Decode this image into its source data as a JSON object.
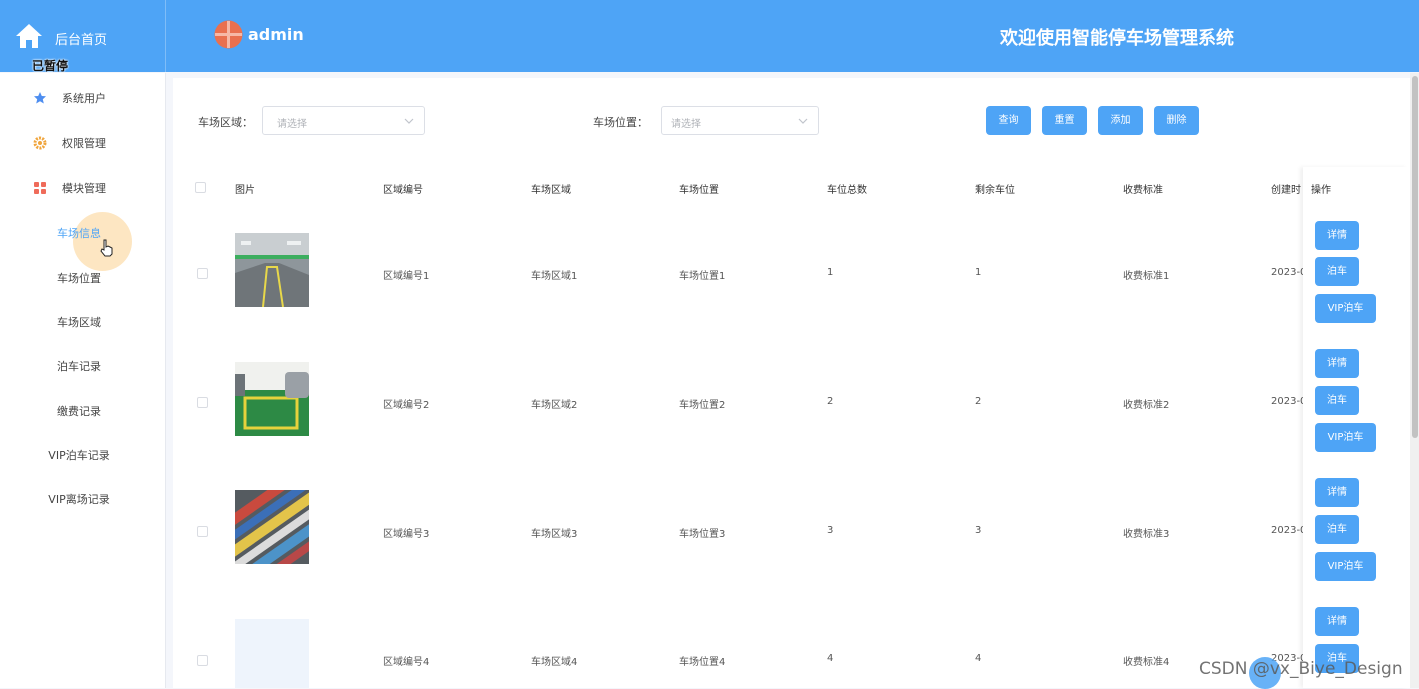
{
  "header": {
    "home_label": "后台首页",
    "paused_label": "已暂停",
    "username": "admin",
    "app_title": "欢迎使用智能停车场管理系统"
  },
  "sidebar": {
    "items": [
      {
        "label": "系统用户",
        "icon": "star-icon"
      },
      {
        "label": "权限管理",
        "icon": "gear-icon"
      },
      {
        "label": "模块管理",
        "icon": "grid-icon"
      }
    ],
    "sub_items": [
      {
        "label": "车场信息",
        "active": true
      },
      {
        "label": "车场位置"
      },
      {
        "label": "车场区域"
      },
      {
        "label": "泊车记录"
      },
      {
        "label": "缴费记录"
      },
      {
        "label": "VIP泊车记录"
      },
      {
        "label": "VIP离场记录"
      }
    ]
  },
  "filters": {
    "area_label": "车场区域：",
    "area_placeholder": "请选择",
    "location_label": "车场位置：",
    "location_placeholder": "请选择"
  },
  "toolbar": {
    "query": "查询",
    "reset": "重置",
    "add": "添加",
    "delete": "删除"
  },
  "table": {
    "columns": [
      "图片",
      "区域编号",
      "车场区域",
      "车场位置",
      "车位总数",
      "剩余车位",
      "收费标准",
      "创建时",
      "操作"
    ],
    "rows": [
      {
        "zone_no": "区域编号1",
        "area": "车场区域1",
        "location": "车场位置1",
        "total": "1",
        "remaining": "1",
        "fee": "收费标准1",
        "created": "2023-0"
      },
      {
        "zone_no": "区域编号2",
        "area": "车场区域2",
        "location": "车场位置2",
        "total": "2",
        "remaining": "2",
        "fee": "收费标准2",
        "created": "2023-0"
      },
      {
        "zone_no": "区域编号3",
        "area": "车场区域3",
        "location": "车场位置3",
        "total": "3",
        "remaining": "3",
        "fee": "收费标准3",
        "created": "2023-0"
      },
      {
        "zone_no": "区域编号4",
        "area": "车场区域4",
        "location": "车场位置4",
        "total": "4",
        "remaining": "4",
        "fee": "收费标准4",
        "created": "2023-0"
      }
    ],
    "actions": {
      "detail": "详情",
      "park": "泊车",
      "vip_park": "VIP泊车"
    }
  },
  "watermark": "CSDN @vx_Biye_Design",
  "colors": {
    "primary": "#4ea4f6",
    "sidebar_active": "#4ea4f6"
  }
}
